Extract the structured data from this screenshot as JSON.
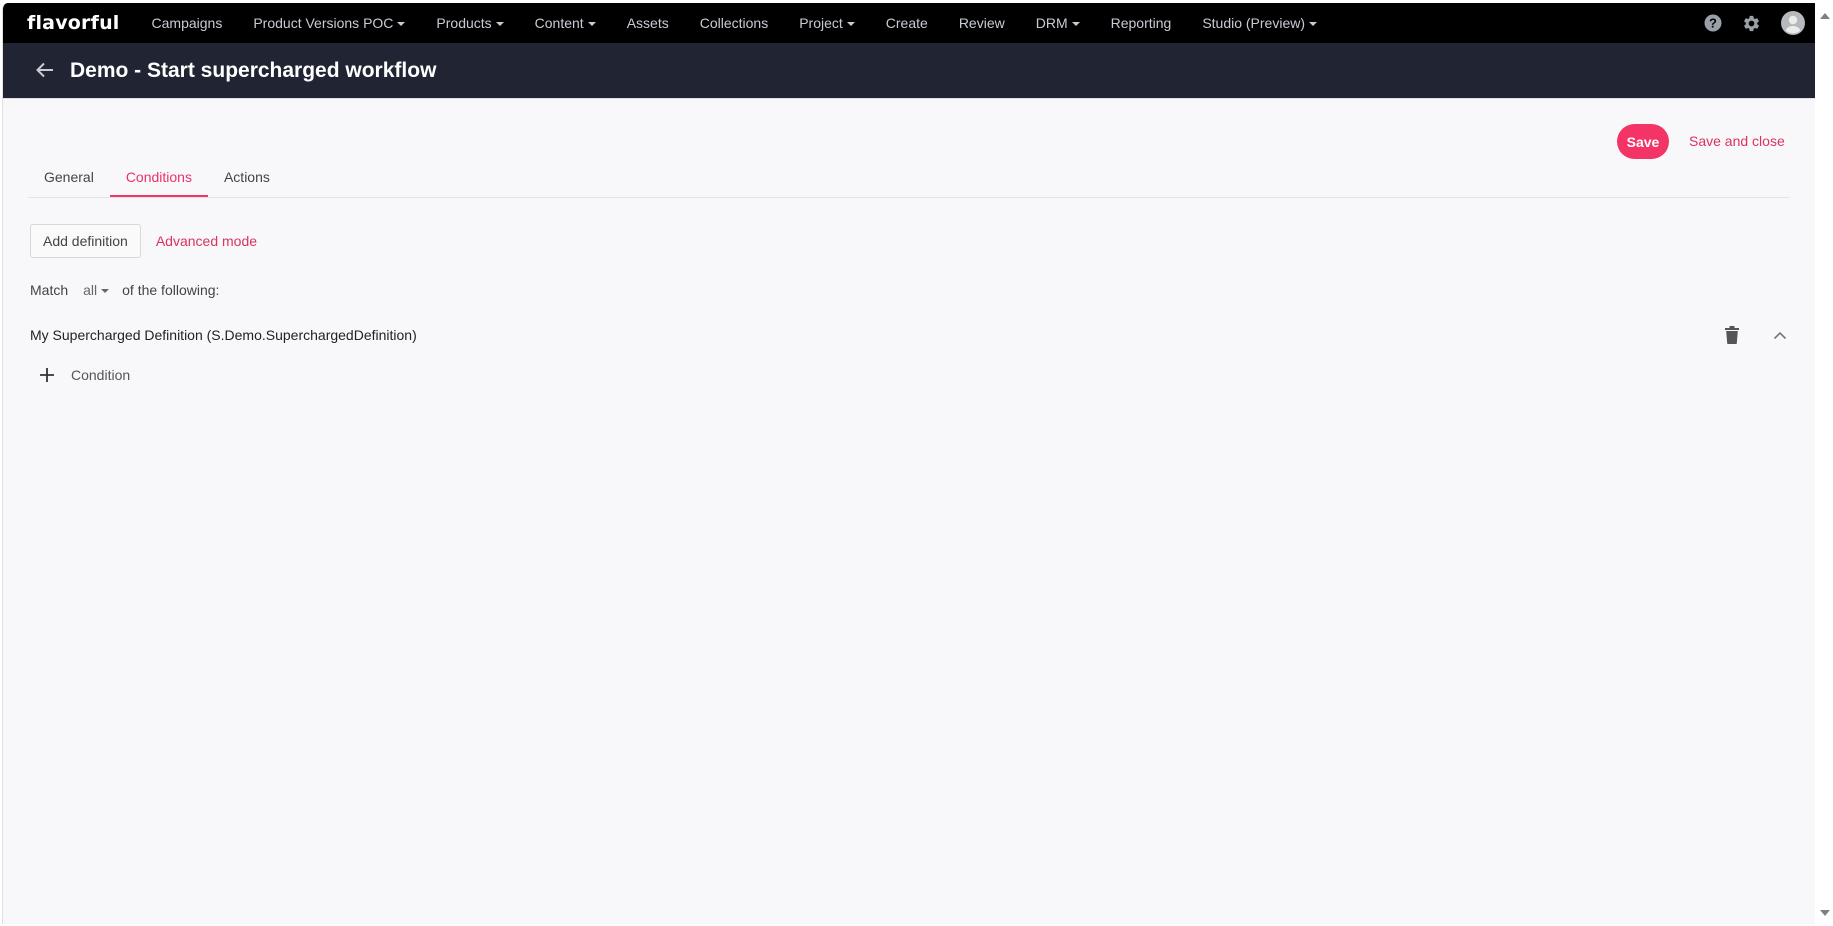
{
  "app": {
    "logo": "flavorful"
  },
  "topnav": {
    "items": [
      {
        "label": "Campaigns",
        "dropdown": false
      },
      {
        "label": "Product Versions POC",
        "dropdown": true
      },
      {
        "label": "Products",
        "dropdown": true
      },
      {
        "label": "Content",
        "dropdown": true
      },
      {
        "label": "Assets",
        "dropdown": false
      },
      {
        "label": "Collections",
        "dropdown": false
      },
      {
        "label": "Project",
        "dropdown": true
      },
      {
        "label": "Create",
        "dropdown": false
      },
      {
        "label": "Review",
        "dropdown": false
      },
      {
        "label": "DRM",
        "dropdown": true
      },
      {
        "label": "Reporting",
        "dropdown": false
      },
      {
        "label": "Studio (Preview)",
        "dropdown": true
      }
    ],
    "icons": [
      "help-icon",
      "gear-icon",
      "user-avatar-icon"
    ]
  },
  "header": {
    "title": "Demo - Start supercharged workflow",
    "back_icon": "arrow-left-icon"
  },
  "toolbar": {
    "save_label": "Save",
    "save_close_label": "Save and close",
    "accent_color": "#f43366"
  },
  "tabs": [
    {
      "label": "General",
      "active": false
    },
    {
      "label": "Conditions",
      "active": true
    },
    {
      "label": "Actions",
      "active": false
    }
  ],
  "conditions": {
    "add_definition_label": "Add definition",
    "advanced_mode_label": "Advanced mode",
    "match_prefix": "Match",
    "match_value": "all",
    "match_suffix": "of the following:",
    "definition_title": "My Supercharged Definition (S.Demo.SuperchargedDefinition)",
    "add_condition_label": "Condition"
  }
}
